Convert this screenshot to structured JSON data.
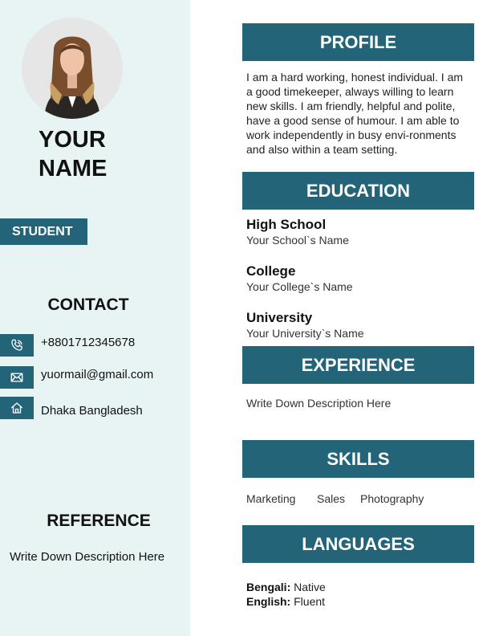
{
  "header": {
    "name_line1": "YOUR",
    "name_line2": "NAME",
    "role": "STUDENT"
  },
  "contact": {
    "title": "CONTACT",
    "items": [
      {
        "icon": "phone-icon",
        "value": "+8801712345678"
      },
      {
        "icon": "mail-icon",
        "value": "yuormail@gmail.com"
      },
      {
        "icon": "home-icon",
        "value": "Dhaka Bangladesh"
      }
    ]
  },
  "reference": {
    "title": "REFERENCE",
    "description": "Write Down Description Here"
  },
  "profile": {
    "title": "PROFILE",
    "text": "I am a hard working, honest individual. I am a good timekeeper, always willing to learn new skills. I am friendly, helpful and polite, have a good sense of humour. I am able to work independently in busy envi-ronments and also within a team setting."
  },
  "education": {
    "title": "EDUCATION",
    "entries": [
      {
        "level": "High School",
        "school": "Your School`s Name"
      },
      {
        "level": "College",
        "school": "Your College`s Name"
      },
      {
        "level": "University",
        "school": "Your University`s Name"
      }
    ]
  },
  "experience": {
    "title": "EXPERIENCE",
    "description": "Write Down Description Here"
  },
  "skills": {
    "title": "SKILLS",
    "items": [
      "Marketing",
      "Sales",
      "Photography"
    ]
  },
  "languages": {
    "title": "LANGUAGES",
    "entries": [
      {
        "language": "Bengali:",
        "level": "Native"
      },
      {
        "language": "English:",
        "level": "Fluent"
      }
    ]
  },
  "colors": {
    "accent": "#236479",
    "sidebar_bg": "#e8f4f4"
  }
}
